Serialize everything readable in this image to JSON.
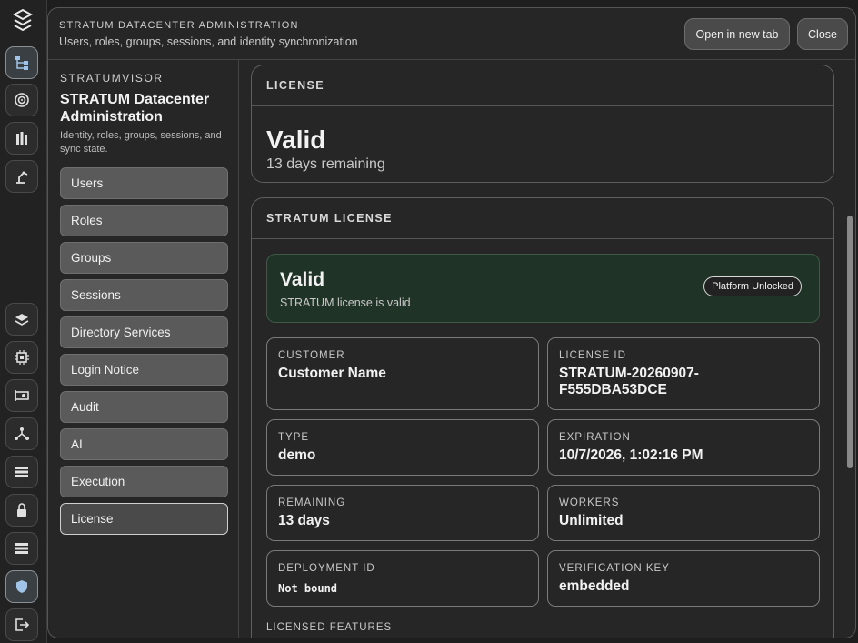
{
  "header": {
    "kicker": "STRATUM DATACENTER ADMINISTRATION",
    "subtitle": "Users, roles, groups, sessions, and identity synchronization",
    "open_new_tab": "Open in new tab",
    "close": "Close"
  },
  "rail": {
    "icons": [
      "logo-icon",
      "hierarchy-icon",
      "target-icon",
      "building-icon",
      "robot-arm-icon",
      "layers-icon",
      "cpu-icon",
      "gpu-card-icon",
      "network-icon",
      "server-list-icon",
      "lock-icon",
      "storage-icon",
      "shield-icon",
      "logout-icon"
    ]
  },
  "sidebar": {
    "kicker": "STRATUMVISOR",
    "title": "STRATUM Datacenter Administration",
    "description": "Identity, roles, groups, sessions, and sync state.",
    "items": [
      {
        "label": "Users"
      },
      {
        "label": "Roles"
      },
      {
        "label": "Groups"
      },
      {
        "label": "Sessions"
      },
      {
        "label": "Directory Services"
      },
      {
        "label": "Login Notice"
      },
      {
        "label": "Audit"
      },
      {
        "label": "AI"
      },
      {
        "label": "Execution"
      },
      {
        "label": "License"
      }
    ],
    "active": "License"
  },
  "license_card": {
    "heading": "LICENSE",
    "status": "Valid",
    "remaining": "13 days remaining"
  },
  "stratum_card": {
    "heading": "STRATUM LICENSE",
    "status": "Valid",
    "status_text": "STRATUM license is valid",
    "badge": "Platform Unlocked",
    "fields": [
      {
        "label": "CUSTOMER",
        "value": "Customer Name"
      },
      {
        "label": "LICENSE ID",
        "value": "STRATUM-20260907-F555DBA53DCE"
      },
      {
        "label": "TYPE",
        "value": "demo"
      },
      {
        "label": "EXPIRATION",
        "value": "10/7/2026, 1:02:16 PM"
      },
      {
        "label": "REMAINING",
        "value": "13 days"
      },
      {
        "label": "WORKERS",
        "value": "Unlimited"
      },
      {
        "label": "DEPLOYMENT ID",
        "value": "Not bound"
      },
      {
        "label": "VERIFICATION KEY",
        "value": "embedded"
      }
    ],
    "features_label": "LICENSED FEATURES"
  },
  "colors": {
    "accent_green_bg": "#1f3326",
    "panel_bg": "#262626",
    "nav_bg": "#5a5a5a"
  }
}
